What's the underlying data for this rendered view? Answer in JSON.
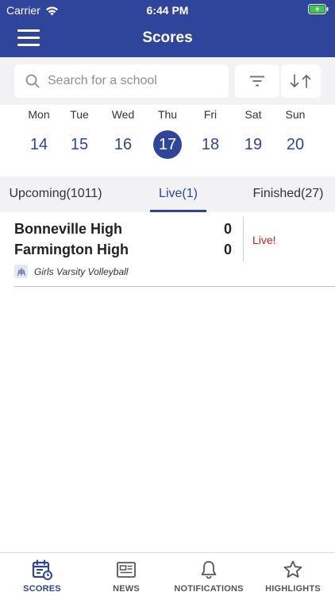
{
  "status_bar": {
    "carrier": "Carrier",
    "time": "6:44 PM"
  },
  "header": {
    "title": "Scores"
  },
  "search": {
    "placeholder": "Search for a school"
  },
  "week": {
    "days": [
      {
        "name": "Mon",
        "date": "14"
      },
      {
        "name": "Tue",
        "date": "15"
      },
      {
        "name": "Wed",
        "date": "16"
      },
      {
        "name": "Thu",
        "date": "17",
        "selected": true
      },
      {
        "name": "Fri",
        "date": "18"
      },
      {
        "name": "Sat",
        "date": "19"
      },
      {
        "name": "Sun",
        "date": "20"
      }
    ]
  },
  "tabs": {
    "upcoming": "Upcoming(1011)",
    "live": "Live(1)",
    "finished": "Finished(27)",
    "active": "live"
  },
  "game": {
    "home_team": "Bonneville High",
    "home_score": "0",
    "away_team": "Farmington High",
    "away_score": "0",
    "status": "Live!",
    "sport": "Girls Varsity Volleyball"
  },
  "bottom_nav": {
    "scores": "SCORES",
    "news": "NEWS",
    "notifications": "NOTIFICATIONS",
    "highlights": "HIGHLIGHTS",
    "active": "scores"
  },
  "colors": {
    "primary": "#2f459b",
    "live": "#c0211f",
    "battery": "#3cc84a"
  }
}
